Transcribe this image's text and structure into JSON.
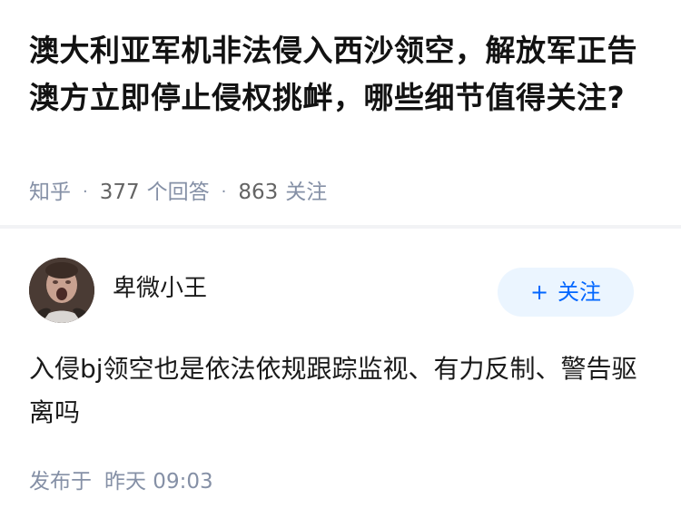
{
  "question": {
    "title": "澳大利亚军机非法侵入西沙领空，解放军正告澳方立即停止侵权挑衅，哪些细节值得关注?",
    "source": "知乎",
    "answer_count": "377",
    "answer_label": "个回答",
    "follow_count": "863",
    "follow_label": "关注"
  },
  "answer": {
    "author_name": "卑微小王",
    "follow_button": {
      "icon": "plus-icon",
      "plus_symbol": "+",
      "label": "关注"
    },
    "content": "入侵bj领空也是依法依规跟踪监视、有力反制、警告驱离吗",
    "published_label": "发布于",
    "published_time": "昨天 09:03"
  },
  "colors": {
    "title_text": "#121212",
    "meta_text": "#8590a6",
    "accent_blue": "#0066ff",
    "follow_button_bg": "#ebf5ff",
    "divider": "#f2f3f5"
  }
}
